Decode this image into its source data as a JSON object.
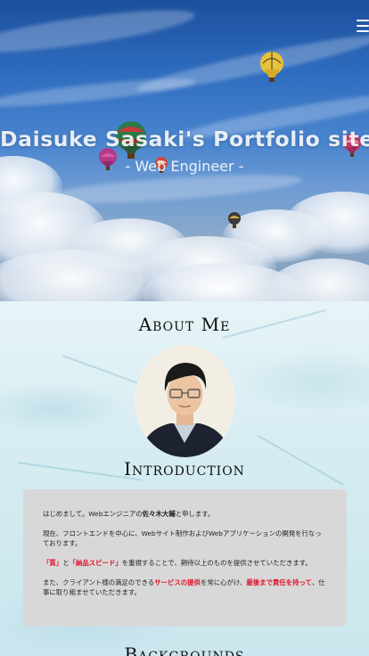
{
  "hero": {
    "title": "Daisuke Sasaki's Portfolio site",
    "subtitle": "- Web Engineer -",
    "menu_icon": "hamburger-menu-icon"
  },
  "about": {
    "title": "About Me"
  },
  "introduction": {
    "title": "Introduction",
    "p1_a": "はじめまして。Webエンジニアの",
    "p1_name": "佐々木大輔",
    "p1_b": "と申します。",
    "p2": "現在、フロントエンドを中心に、Webサイト制作およびWebアプリケーションの開発を行なっております。",
    "p3_q1": "「質」",
    "p3_and": "と",
    "p3_q2": "「納品スピード」",
    "p3_rest": "を重視することで、期待以上のものを提供させていただきます。",
    "p4_a": "また、クライアント様の満足のできる",
    "p4_hl1": "サービスの提供",
    "p4_b": "を常に心がけ、",
    "p4_hl2": "最後まで責任を持って",
    "p4_c": "、仕事に取り組ませていただきます。"
  },
  "backgrounds": {
    "title": "Backgrounds"
  },
  "colors": {
    "highlight": "#e0122b",
    "intro_box_bg": "#d8d8d8",
    "heading": "#111111"
  }
}
